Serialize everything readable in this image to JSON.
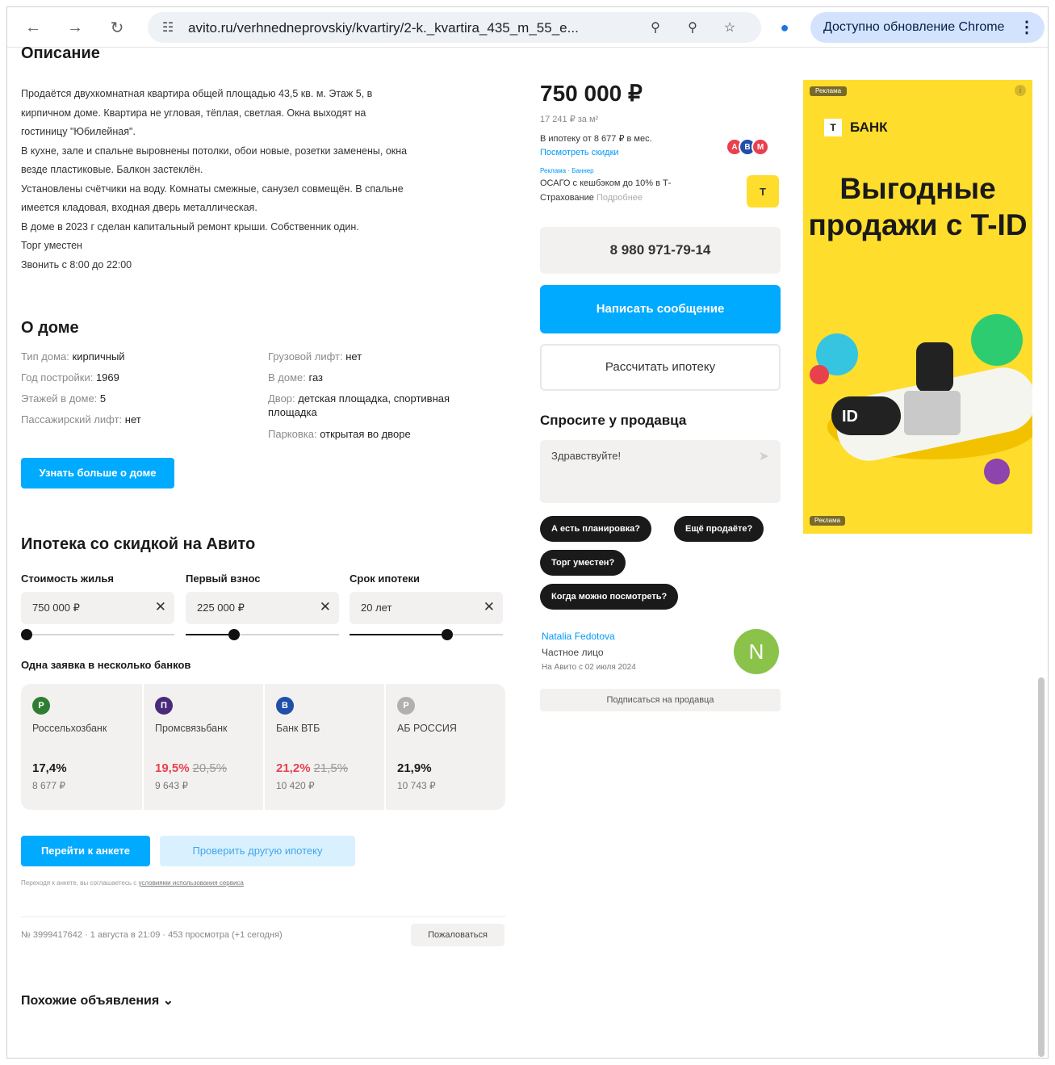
{
  "browser": {
    "url": "avito.ru/verhnedneprovskiy/kvartiry/2-k._kvartira_435_m_55_e...",
    "update_label": "Доступно обновление Chrome"
  },
  "description": {
    "heading": "Описание",
    "lines": [
      "Продаётся двухкомнатная квартира общей площадью 43,5 кв. м. Этаж 5, в",
      "кирпичном доме. Квартира не угловая, тёплая, светлая. Окна выходят на",
      "гостиницу \"Юбилейная\".",
      "В кухне, зале и спальне выровнены потолки, обои новые, розетки заменены, окна",
      "везде пластиковые. Балкон застеклён.",
      "Установлены счётчики на воду. Комнаты смежные, санузел совмещён. В спальне",
      "имеется кладовая, входная дверь металлическая.",
      "В доме в 2023 г сделан капитальный ремонт крыши. Собственник один.",
      "Торг уместен",
      "Звонить с 8:00 до 22:00"
    ]
  },
  "house": {
    "heading": "О доме",
    "left": [
      {
        "k": "Тип дома:",
        "v": "кирпичный"
      },
      {
        "k": "Год постройки:",
        "v": "1969"
      },
      {
        "k": "Этажей в доме:",
        "v": "5"
      },
      {
        "k": "Пассажирский лифт:",
        "v": "нет"
      }
    ],
    "right": [
      {
        "k": "Грузовой лифт:",
        "v": "нет"
      },
      {
        "k": "В доме:",
        "v": "газ"
      },
      {
        "k": "Двор:",
        "v": "детская площадка, спортивная площадка"
      },
      {
        "k": "Парковка:",
        "v": "открытая во дворе"
      }
    ],
    "more_button": "Узнать больше о доме"
  },
  "mortgage": {
    "heading": "Ипотека со скидкой на Авито",
    "fields": [
      {
        "label": "Стоимость жилья",
        "value": "750 000 ₽",
        "fill": 0.0
      },
      {
        "label": "Первый взнос",
        "value": "225 000 ₽",
        "fill": 0.3
      },
      {
        "label": "Срок ипотеки",
        "value": "20 лет",
        "fill": 0.65
      }
    ],
    "banks_heading": "Одна заявка в несколько банков",
    "banks": [
      {
        "name": "Россельхозбанк",
        "rate": "17,4%",
        "old_rate": "",
        "payment": "8 677 ₽",
        "color": "#2e7d32",
        "logo": "Р"
      },
      {
        "name": "Промсвязьбанк",
        "rate": "19,5%",
        "old_rate": "20,5%",
        "payment": "9 643 ₽",
        "color": "#4a2a7a",
        "logo": "П"
      },
      {
        "name": "Банк ВТБ",
        "rate": "21,2%",
        "old_rate": "21,5%",
        "payment": "10 420 ₽",
        "color": "#1f4fa8",
        "logo": "В"
      },
      {
        "name": "АБ РОССИЯ",
        "rate": "21,9%",
        "old_rate": "",
        "payment": "10 743 ₽",
        "color": "#b0b0b0",
        "logo": "Р"
      }
    ],
    "apply_button": "Перейти к анкете",
    "check_button": "Проверить другую ипотеку",
    "disclaimer_text": "Переходя к анкете, вы соглашаетесь с ",
    "disclaimer_link": "условиями использования сервиса"
  },
  "meta": {
    "line": "№ 3999417642 · 1 августа в 21:09 · 453 просмотра (+1 сегодня)",
    "complain": "Пожаловаться"
  },
  "similar": {
    "label": "Похожие объявления"
  },
  "sidebar": {
    "price": "750 000 ₽",
    "price_per_m2": "17 241 ₽ за м²",
    "mortgage_line": "В ипотеку от 8 677 ₽ в мес.",
    "offers_link": "Посмотреть скидки",
    "promo_small": "Реклама · Баннер",
    "osago_line": "ОСАГО с кешбэком до 10% в Т-",
    "insurance_line": "Страхование",
    "insurance_link": "Подробнее",
    "phone_button": "8 980 971-79-14",
    "message_button": "Написать сообщение",
    "calc_button": "Рассчитать ипотеку",
    "ask_heading": "Спросите у продавца",
    "ask_placeholder": "Здравствуйте!",
    "chips": [
      "А есть планировка?",
      "Ещё продаёте?",
      "Торг уместен?",
      "Когда можно посмотреть?"
    ],
    "seller_name": "Natalia Fedotova",
    "seller_type": "Частное лицо",
    "seller_since": "На Авито с 02 июля 2024",
    "avatar_letter": "N",
    "subscribe_button": "Подписаться на продавца"
  },
  "ad": {
    "label": "Реклама",
    "brand": "БАНК",
    "title": "Выгодные продажи с T-ID",
    "bottom_label": "Реклама"
  }
}
